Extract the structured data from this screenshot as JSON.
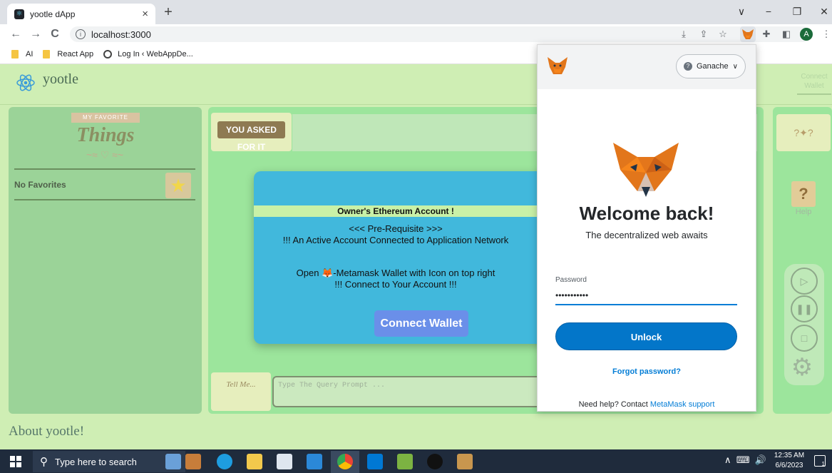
{
  "browser": {
    "tab_title": "yootle dApp",
    "tab_close": "×",
    "new_tab": "+",
    "url": "localhost:3000",
    "nav": {
      "back": "←",
      "forward": "→",
      "reload": "C"
    },
    "window": {
      "collapse": "∨",
      "minimize": "−",
      "restore": "❐",
      "close": "✕"
    },
    "avatar_letter": "A",
    "bookmarks": [
      {
        "label": "AI",
        "icon": "folder-icon"
      },
      {
        "label": "React App",
        "icon": "folder-icon"
      },
      {
        "label": "Log In ‹ WebAppDe...",
        "icon": "globe-icon"
      }
    ]
  },
  "app": {
    "brand": "yootle",
    "connect_top": "Connect Wallet",
    "favorites": {
      "banner_top": "MY FAVORITE",
      "banner_main": "Things",
      "empty_text": "No Favorites"
    },
    "asked_badge": "YOU ASKED FOR IT",
    "tell_me": "Tell Me...",
    "query_placeholder": "Type The Query Prompt ...",
    "help_label": "Help",
    "footer": "About yootle!",
    "modal": {
      "title": "Owner's Ethereum Account !",
      "line1": "<<< Pre-Requisite >>>",
      "line2": "!!! An Active Account Connected to Application Network",
      "line3_prefix": "Open ",
      "line3_suffix": "-Metamask Wallet with Icon on top right",
      "line4": "!!! Connect to Your Account !!!",
      "button": "Connect Wallet"
    }
  },
  "metamask": {
    "network": "Ganache",
    "welcome": "Welcome back!",
    "tagline": "The decentralized web awaits",
    "password_label": "Password",
    "password_value": "•••••••••••",
    "unlock": "Unlock",
    "forgot": "Forgot password?",
    "help_prefix": "Need help? Contact ",
    "help_link": "MetaMask support"
  },
  "taskbar": {
    "search_placeholder": "Type here to search",
    "time": "12:35 AM",
    "date": "6/6/2023",
    "notification_count": "1"
  },
  "colors": {
    "app_bg": "#cfeeb4",
    "panel_green": "#9ce59c",
    "modal_blue": "#41b8dc",
    "metamask_blue": "#0376c9",
    "taskbar": "#1f2b3c"
  }
}
